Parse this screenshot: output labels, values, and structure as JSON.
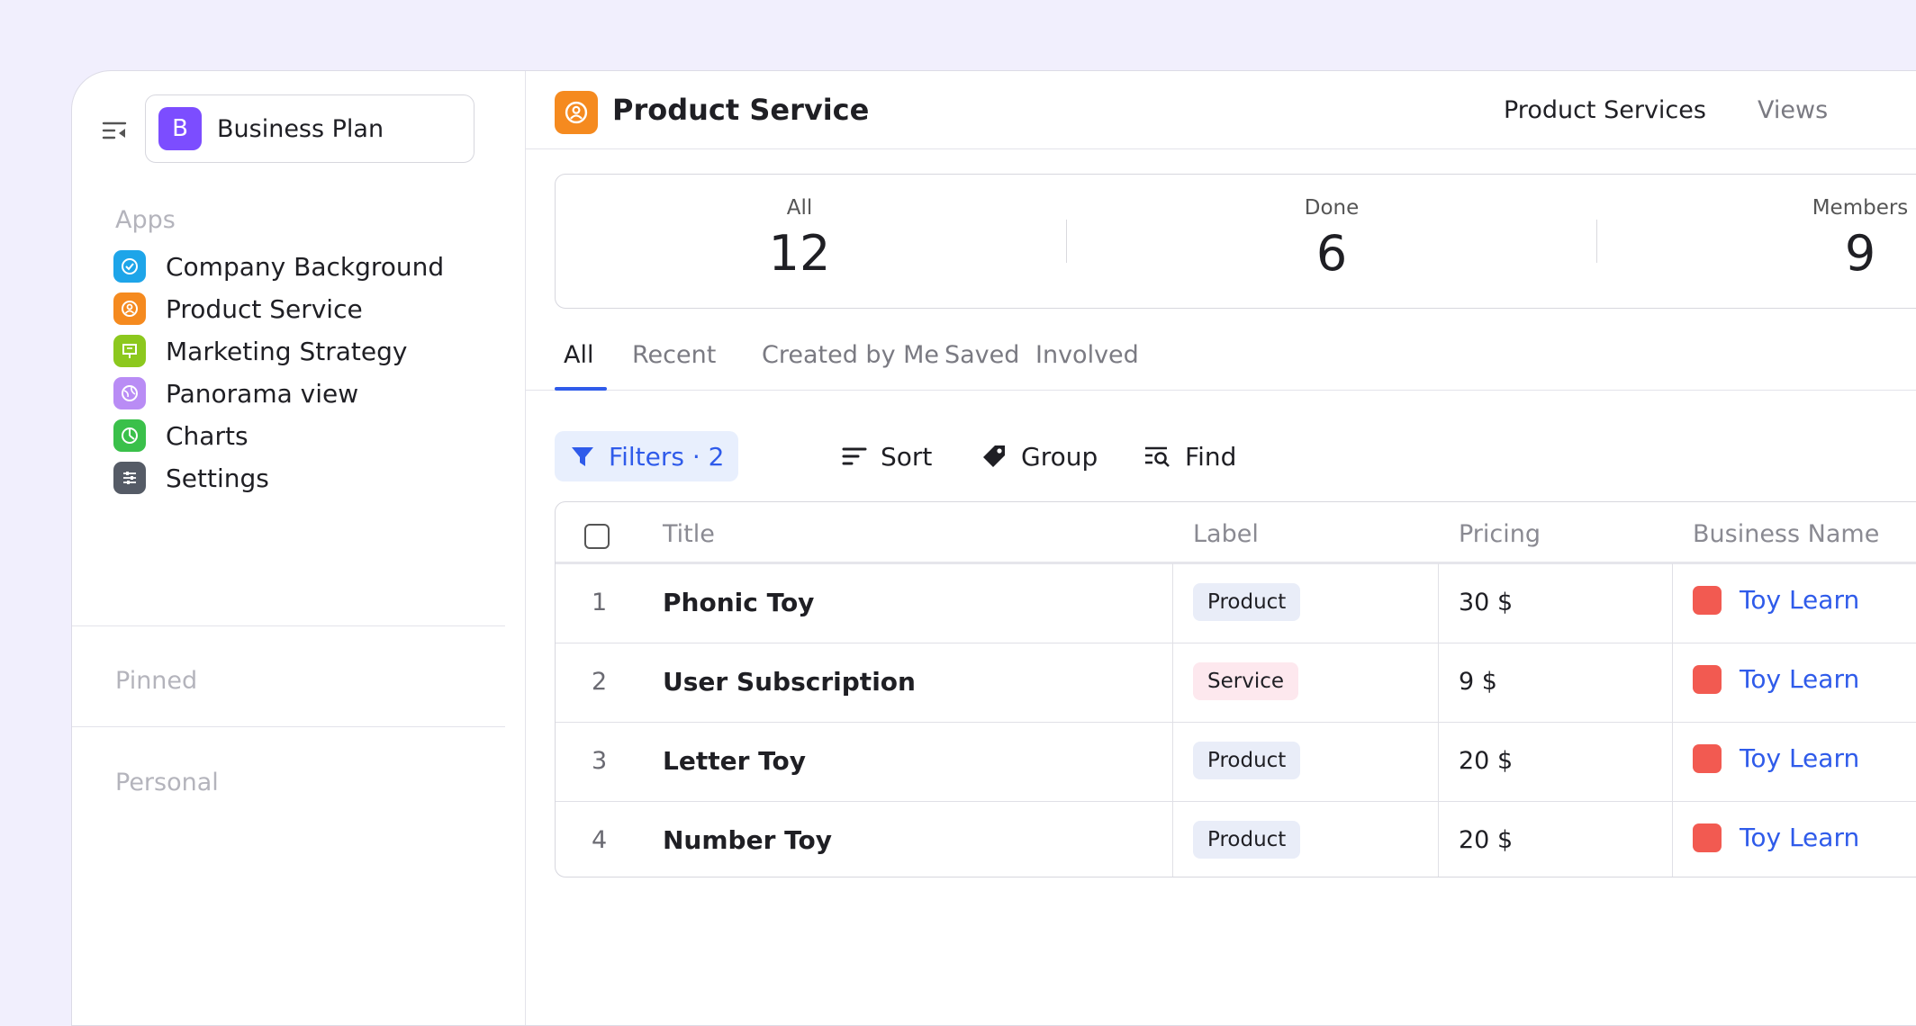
{
  "workspace": {
    "avatar_letter": "B",
    "name": "Business Plan",
    "avatar_color": "#7c4dff"
  },
  "sidebar": {
    "apps_label": "Apps",
    "items": [
      {
        "label": "Company Background",
        "icon": "check-circle-icon",
        "color": "#1ea5e9"
      },
      {
        "label": "Product Service",
        "icon": "user-circle-icon",
        "color": "#f58a1f"
      },
      {
        "label": "Marketing Strategy",
        "icon": "presentation-icon",
        "color": "#8cc81e"
      },
      {
        "label": "Panorama view",
        "icon": "globe-icon",
        "color": "#b98cf5"
      },
      {
        "label": "Charts",
        "icon": "pie-chart-icon",
        "color": "#3ac04a"
      },
      {
        "label": "Settings",
        "icon": "sliders-icon",
        "color": "#555b66"
      }
    ],
    "pinned_label": "Pinned",
    "personal_label": "Personal"
  },
  "header": {
    "title": "Product Service",
    "icon_color": "#f58a1f",
    "link_active": "Product Services",
    "link_other": "Views"
  },
  "stats": [
    {
      "label": "All",
      "value": "12"
    },
    {
      "label": "Done",
      "value": "6"
    },
    {
      "label": "Members",
      "value": "9"
    }
  ],
  "tabs": [
    "All",
    "Recent",
    "Created by Me",
    "Saved",
    "Involved"
  ],
  "active_tab": "All",
  "toolbar": {
    "filters": "Filters · 2",
    "sort": "Sort",
    "group": "Group",
    "find": "Find"
  },
  "table": {
    "columns": [
      "Title",
      "Label",
      "Pricing",
      "Business Name"
    ],
    "rows": [
      {
        "num": "1",
        "title": "Phonic Toy",
        "label": "Product",
        "label_type": "product",
        "pricing": "30 $",
        "business": "Toy Learn"
      },
      {
        "num": "2",
        "title": "User Subscription",
        "label": "Service",
        "label_type": "service",
        "pricing": "9 $",
        "business": "Toy Learn"
      },
      {
        "num": "3",
        "title": "Letter Toy",
        "label": "Product",
        "label_type": "product",
        "pricing": "20 $",
        "business": "Toy Learn"
      },
      {
        "num": "4",
        "title": "Number Toy",
        "label": "Product",
        "label_type": "product",
        "pricing": "20 $",
        "business": "Toy Learn"
      }
    ]
  },
  "colors": {
    "accent": "#2f5bea",
    "business_square": "#f25a51",
    "background": "#f1effd"
  }
}
